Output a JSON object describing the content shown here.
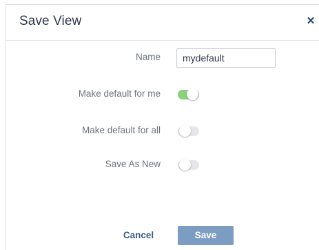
{
  "dialog": {
    "title": "Save View",
    "close_icon": "close-icon",
    "close_glyph": "×"
  },
  "form": {
    "name": {
      "label": "Name",
      "value": "mydefault"
    },
    "make_default_for_me": {
      "label": "Make default for me",
      "on": true
    },
    "make_default_for_all": {
      "label": "Make default for all",
      "on": false
    },
    "save_as_new": {
      "label": "Save As New",
      "on": false
    }
  },
  "footer": {
    "cancel_label": "Cancel",
    "save_label": "Save"
  },
  "colors": {
    "toggle_on": "#8bd17c",
    "toggle_off": "#e5e7ea",
    "save_button": "#7d9cc1",
    "cancel_text": "#3e5e86",
    "title_text": "#2f3a4b"
  }
}
